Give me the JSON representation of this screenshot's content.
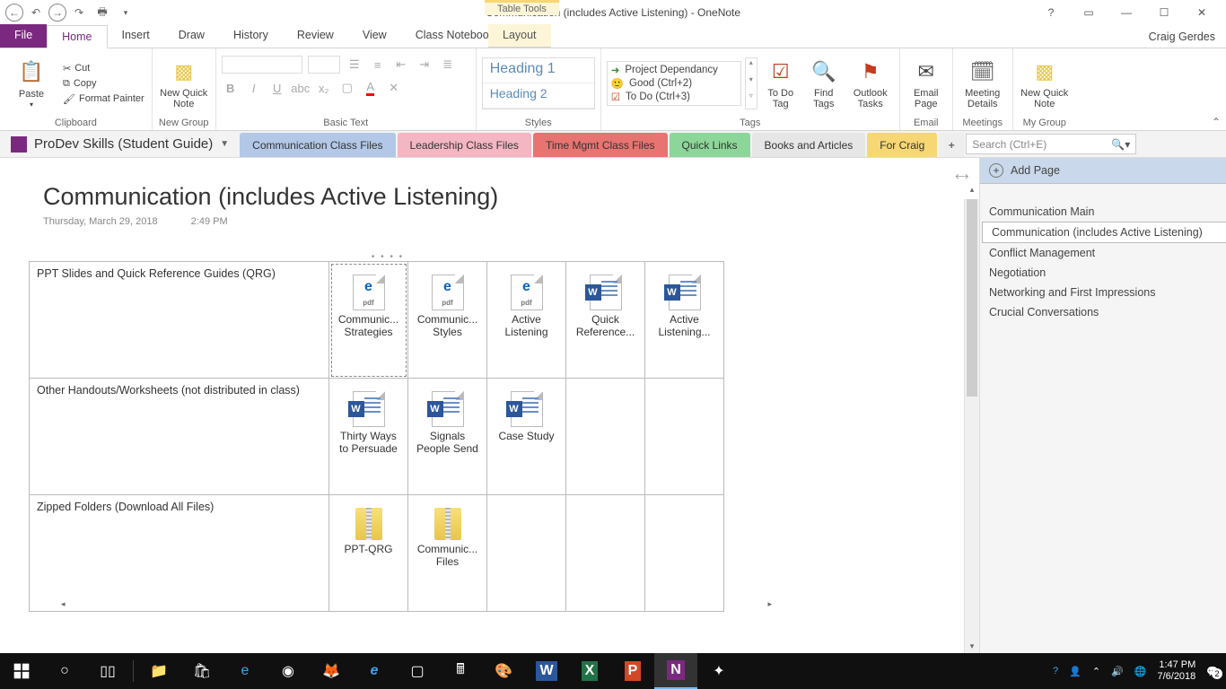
{
  "titlebar": {
    "title": "Communication (includes Active Listening) - OneNote",
    "table_tools": "Table Tools",
    "help": "?",
    "user": "Craig Gerdes"
  },
  "menutabs": {
    "file": "File",
    "items": [
      "Home",
      "Insert",
      "Draw",
      "History",
      "Review",
      "View",
      "Class Notebook"
    ],
    "layout": "Layout"
  },
  "ribbon": {
    "clipboard": {
      "label": "Clipboard",
      "paste": "Paste",
      "cut": "Cut",
      "copy": "Copy",
      "format_painter": "Format Painter"
    },
    "newgroup": {
      "label": "New Group",
      "new_quick_note": "New Quick Note"
    },
    "basictext": {
      "label": "Basic Text"
    },
    "styles": {
      "label": "Styles",
      "h1": "Heading 1",
      "h2": "Heading 2"
    },
    "tags": {
      "label": "Tags",
      "items": [
        "Project Dependancy",
        "Good (Ctrl+2)",
        "To Do (Ctrl+3)"
      ],
      "todo_tag": "To Do Tag",
      "find_tags": "Find Tags",
      "outlook_tasks": "Outlook Tasks"
    },
    "email": {
      "label": "Email",
      "email_page": "Email Page"
    },
    "meetings": {
      "label": "Meetings",
      "meeting_details": "Meeting Details"
    },
    "mygroup": {
      "label": "My Group",
      "new_quick_note": "New Quick Note"
    }
  },
  "notebook_bar": {
    "notebook": "ProDev Skills (Student Guide)",
    "sections": [
      {
        "label": "Communication Class Files",
        "color": "blue",
        "active": true
      },
      {
        "label": "Leadership Class Files",
        "color": "pink"
      },
      {
        "label": "Time Mgmt Class Files",
        "color": "red"
      },
      {
        "label": "Quick Links",
        "color": "green"
      },
      {
        "label": "Books and Articles",
        "color": "grey"
      },
      {
        "label": "For Craig",
        "color": "yellow"
      }
    ],
    "add": "+",
    "search_placeholder": "Search (Ctrl+E)"
  },
  "page": {
    "title": "Communication (includes Active Listening)",
    "date": "Thursday, March 29, 2018",
    "time": "2:49 PM"
  },
  "table": {
    "rows": [
      {
        "header": "PPT Slides and Quick Reference Guides (QRG)",
        "files": [
          {
            "name": "Communic... Strategies",
            "type": "pdf"
          },
          {
            "name": "Communic... Styles",
            "type": "pdf"
          },
          {
            "name": "Active Listening",
            "type": "pdf"
          },
          {
            "name": "Quick Reference...",
            "type": "word"
          },
          {
            "name": "Active Listening...",
            "type": "word"
          }
        ]
      },
      {
        "header": "Other Handouts/Worksheets (not distributed in class)",
        "files": [
          {
            "name": "Thirty Ways to Persuade",
            "type": "word"
          },
          {
            "name": "Signals People Send",
            "type": "word"
          },
          {
            "name": "Case Study",
            "type": "word"
          },
          {
            "name": "",
            "type": ""
          },
          {
            "name": "",
            "type": ""
          }
        ]
      },
      {
        "header": "Zipped Folders (Download All Files)",
        "files": [
          {
            "name": "PPT-QRG",
            "type": "zip"
          },
          {
            "name": "Communic... Files",
            "type": "zip"
          },
          {
            "name": "",
            "type": ""
          },
          {
            "name": "",
            "type": ""
          },
          {
            "name": "",
            "type": ""
          }
        ]
      }
    ]
  },
  "pagepane": {
    "add_page": "Add Page",
    "pages": [
      "Communication Main",
      "Communication (includes Active Listening)",
      "Conflict Management",
      "Negotiation",
      "Networking and First Impressions",
      "Crucial Conversations"
    ],
    "selected_index": 1
  },
  "taskbar": {
    "time": "1:47 PM",
    "date": "7/6/2018",
    "notifications": "2"
  }
}
